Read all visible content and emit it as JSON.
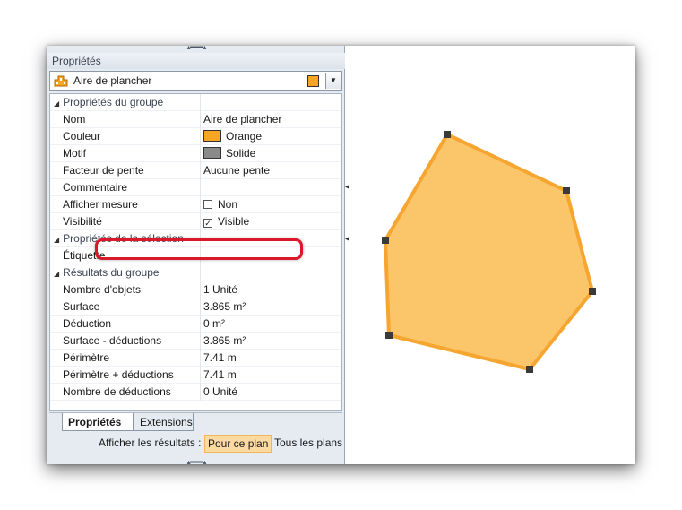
{
  "panel": {
    "title": "Propriétés",
    "selector": {
      "label": "Aire de plancher",
      "swatch_color": "#f6a623"
    }
  },
  "properties": {
    "groups": [
      {
        "label": "Propriétés du groupe",
        "rows": [
          {
            "key": "Nom",
            "value": "Aire de plancher"
          },
          {
            "key": "Couleur",
            "value": "Orange",
            "swatch": "#f6a623"
          },
          {
            "key": "Motif",
            "value": "Solide",
            "swatch": "#8a8a8a"
          },
          {
            "key": "Facteur de pente",
            "value": "Aucune pente"
          },
          {
            "key": "Commentaire",
            "value": ""
          },
          {
            "key": "Afficher mesure",
            "value": "Non",
            "checkbox": false
          },
          {
            "key": "Visibilité",
            "value": "Visible",
            "checkbox": true
          }
        ]
      },
      {
        "label": "Propriétés de la sélection",
        "rows": [
          {
            "key": "Étiquette",
            "value": ""
          }
        ]
      },
      {
        "label": "Résultats du groupe",
        "rows": [
          {
            "key": "Nombre d'objets",
            "value": "1 Unité"
          },
          {
            "key": "Surface",
            "value": "3.865 m²"
          },
          {
            "key": "Déduction",
            "value": "0 m²"
          },
          {
            "key": "Surface - déductions",
            "value": "3.865 m²"
          },
          {
            "key": "Périmètre",
            "value": "7.41 m"
          },
          {
            "key": "Périmètre + déductions",
            "value": "7.41 m"
          },
          {
            "key": "Nombre de déductions",
            "value": "0 Unité"
          }
        ]
      }
    ]
  },
  "tabs": [
    {
      "label": "Propriétés",
      "active": true
    },
    {
      "label": "Extensions",
      "active": false
    }
  ],
  "results": {
    "label": "Afficher les résultats :",
    "option_current": "Pour ce plan",
    "option_all": "Tous les plans"
  },
  "colors": {
    "shape_fill": "#fbc66a",
    "shape_stroke": "#f7a531",
    "vertex": "#3a3a3a",
    "highlight": "#d9182a"
  }
}
